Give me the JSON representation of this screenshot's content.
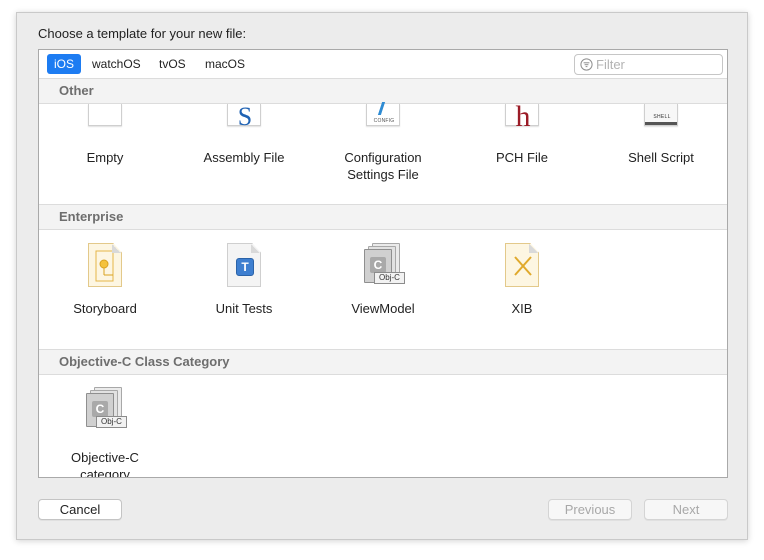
{
  "dialog": {
    "title": "Choose a template for your new file:"
  },
  "platform_tabs": [
    {
      "label": "iOS",
      "selected": true
    },
    {
      "label": "watchOS",
      "selected": false
    },
    {
      "label": "tvOS",
      "selected": false
    },
    {
      "label": "macOS",
      "selected": false
    }
  ],
  "filter": {
    "placeholder": "Filter",
    "value": ""
  },
  "sections": [
    {
      "title": "Other",
      "items": [
        {
          "label": "Empty",
          "icon": "empty-file-icon"
        },
        {
          "label": "Assembly File",
          "icon": "assembly-file-icon",
          "glyph": "S"
        },
        {
          "label": "Configuration Settings File",
          "icon": "config-file-icon",
          "glyph": "CONFIG"
        },
        {
          "label": "PCH File",
          "icon": "pch-file-icon",
          "glyph": "h"
        },
        {
          "label": "Shell Script",
          "icon": "shell-script-icon",
          "glyph": "SHELL"
        }
      ]
    },
    {
      "title": "Enterprise",
      "items": [
        {
          "label": "Storyboard",
          "icon": "storyboard-icon"
        },
        {
          "label": "Unit Tests",
          "icon": "unit-tests-icon",
          "glyph": "T"
        },
        {
          "label": "ViewModel",
          "icon": "objc-class-icon",
          "glyph": "C",
          "tag": "Obj-C"
        },
        {
          "label": "XIB",
          "icon": "xib-icon"
        }
      ]
    },
    {
      "title": "Objective-C Class Category",
      "items": [
        {
          "label": "Objective-C category",
          "icon": "objc-category-icon",
          "glyph": "C",
          "tag": "Obj-C"
        }
      ]
    }
  ],
  "buttons": {
    "cancel": "Cancel",
    "previous": "Previous",
    "next": "Next"
  },
  "colors": {
    "accent": "#1d7cf2",
    "section_header_bg": "#f3f3f3",
    "sheet_bg": "#ececec"
  }
}
